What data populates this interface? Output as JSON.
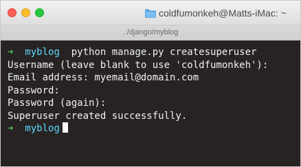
{
  "window": {
    "title": "coldfumonkeh@Matts-iMac: ~",
    "path": "../django/myblog"
  },
  "terminal": {
    "prompt_arrow": "➜",
    "prompt_dir": "myblog",
    "command": "python manage.py createsuperuser",
    "output_lines": [
      "Username (leave blank to use 'coldfumonkeh'):",
      "Email address: myemail@domain.com",
      "Password:",
      "Password (again):",
      "Superuser created successfully."
    ]
  },
  "colors": {
    "prompt_arrow": "#56c556",
    "prompt_dir": "#5fd7ff",
    "background": "#262322",
    "text": "#f2f2f2"
  }
}
